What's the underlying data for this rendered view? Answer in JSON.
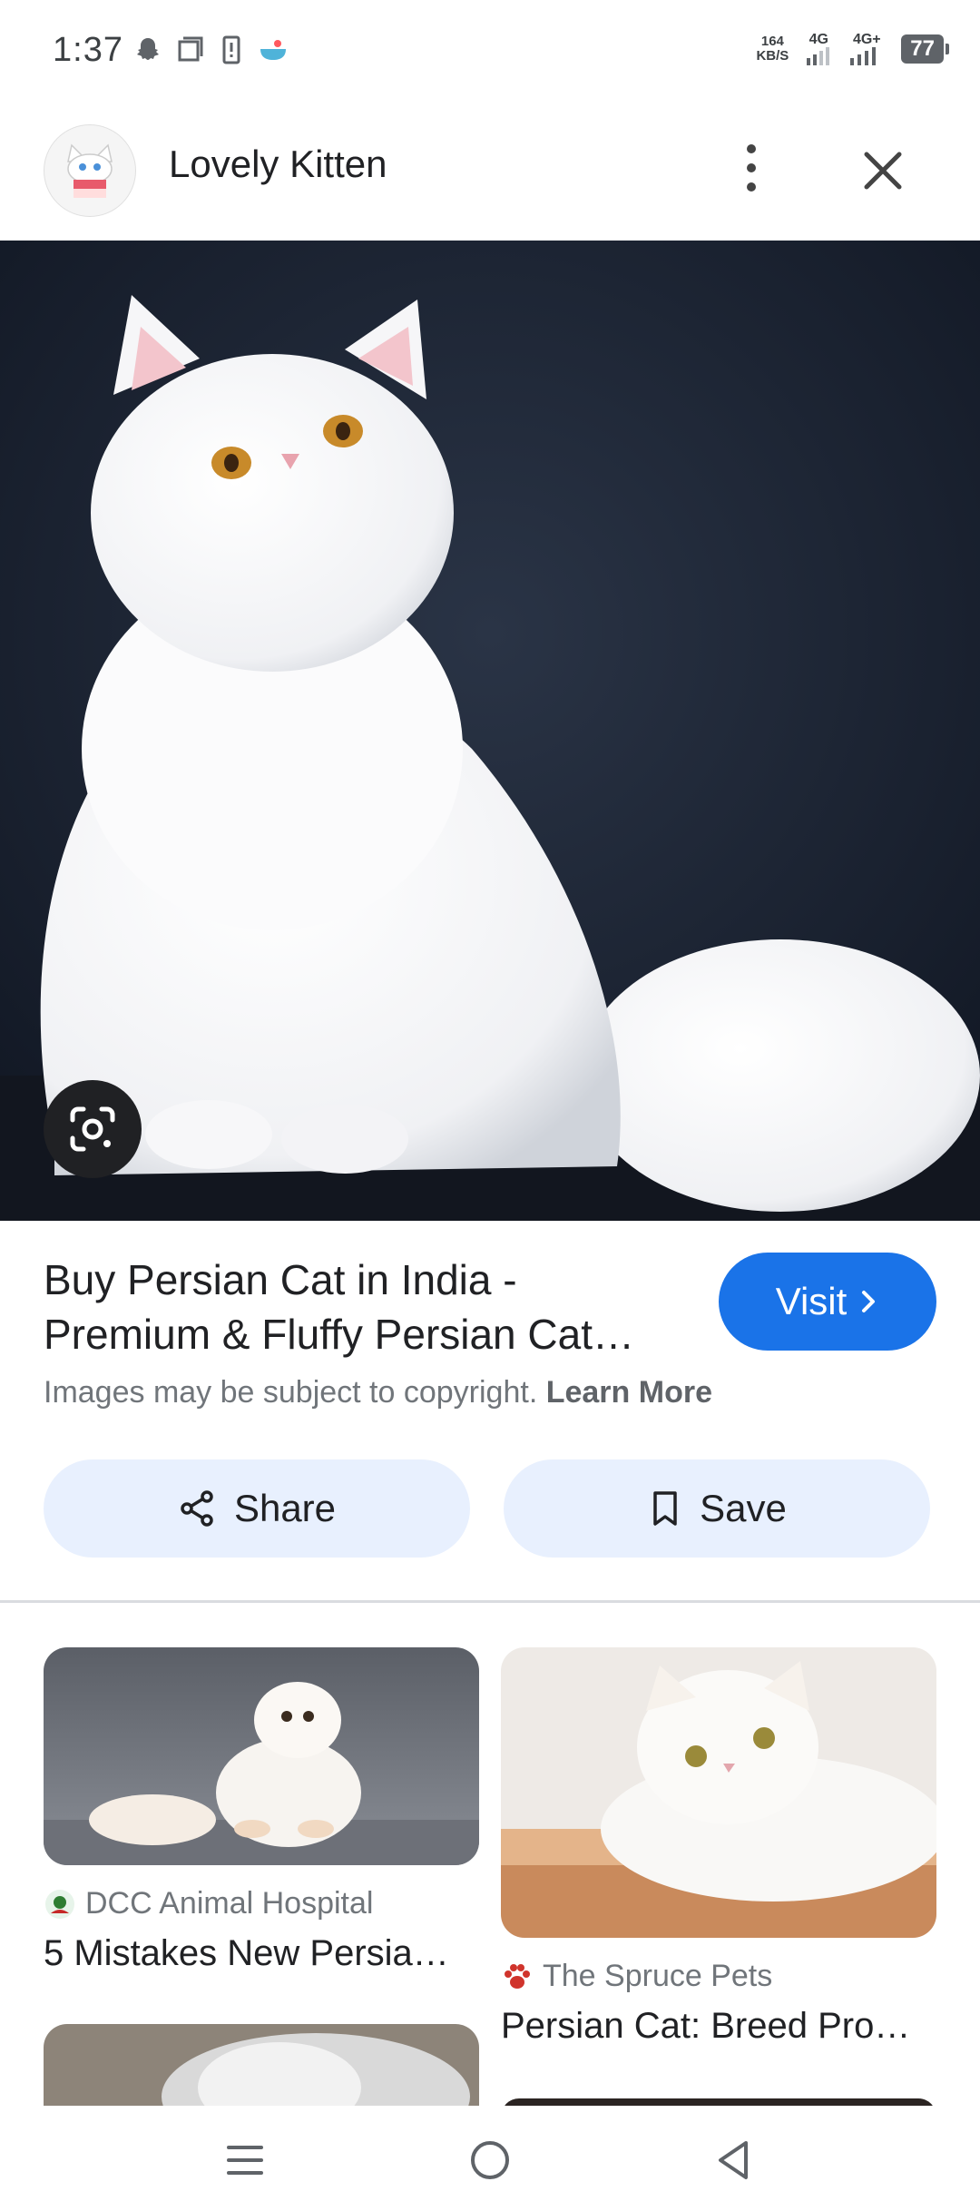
{
  "status_bar": {
    "time": "1:37",
    "net_speed_value": "164",
    "net_speed_unit": "KB/S",
    "sim1": "4G",
    "sim2": "4G+",
    "battery": "77"
  },
  "header": {
    "title": "Lovely Kitten",
    "icons": [
      "more-vert-icon",
      "close-icon"
    ]
  },
  "result": {
    "title": "Buy Persian Cat in India - Premium & Fluffy Persian Cat…",
    "visit_label": "Visit",
    "copyright_text": "Images may be subject to copyright.",
    "learn_more": "Learn More",
    "share_label": "Share",
    "save_label": "Save"
  },
  "related": [
    {
      "source": "DCC Animal Hospital",
      "title": "5 Mistakes New Persia…"
    },
    {
      "source": "The Spruce Pets",
      "title": "Persian Cat: Breed Pro…"
    }
  ],
  "colors": {
    "accent": "#1a73e8",
    "chip_bg": "#e8f0fe",
    "hero_bg": "#1b2230"
  }
}
